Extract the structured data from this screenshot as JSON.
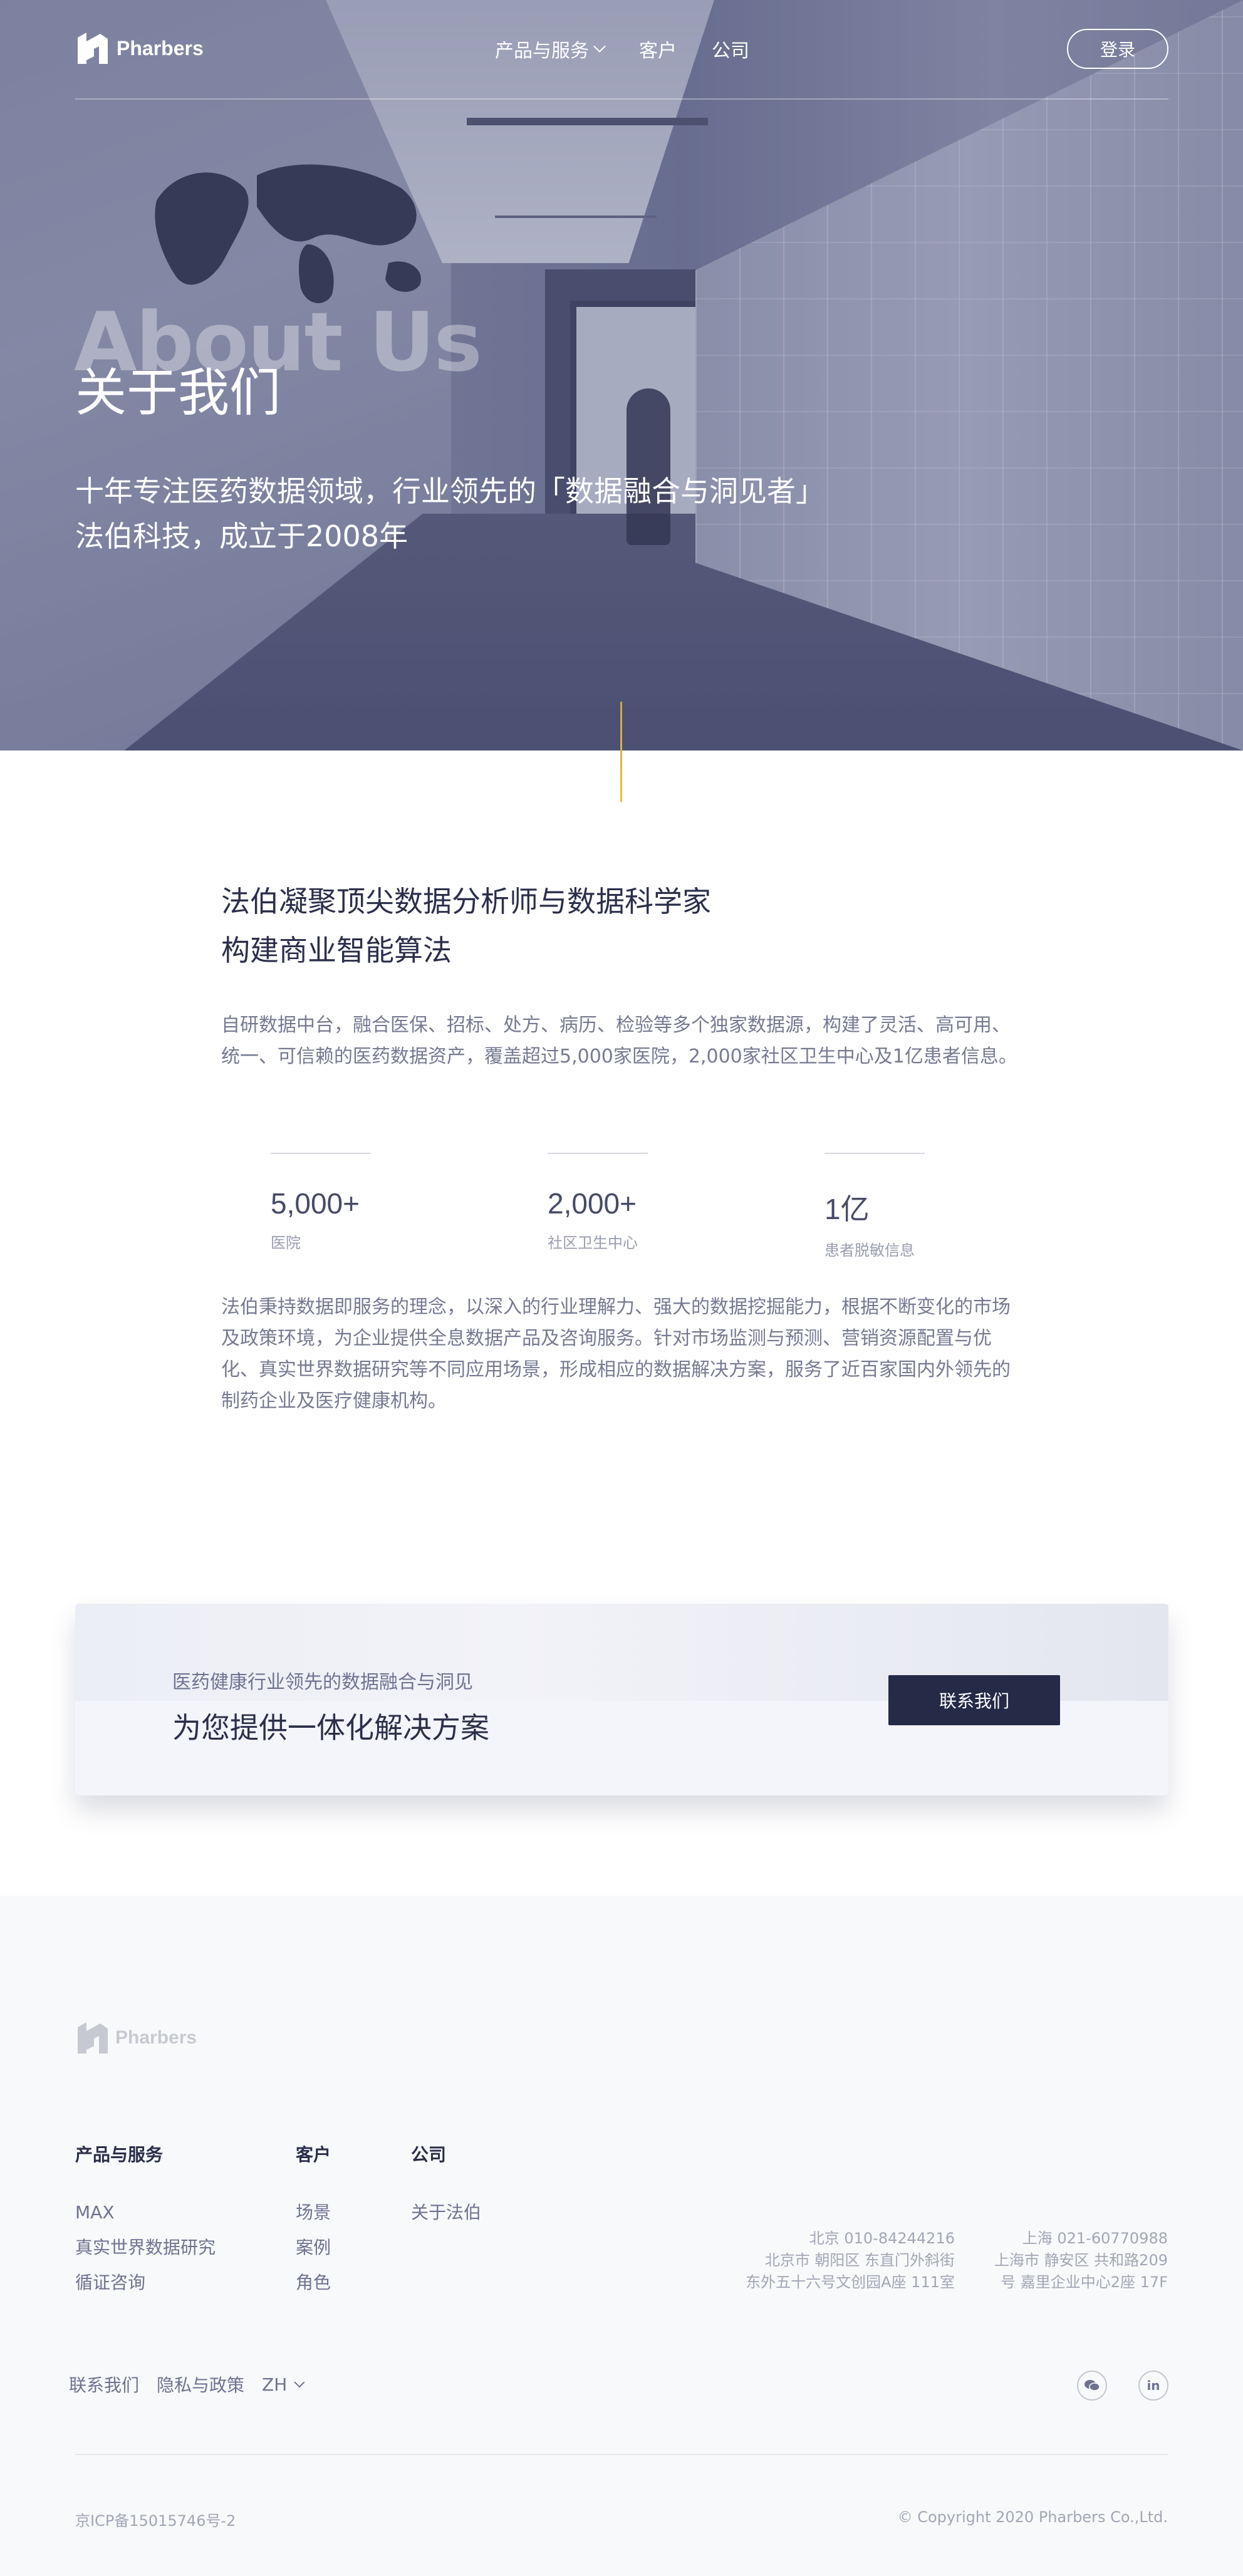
{
  "brand": {
    "name": "Pharbers"
  },
  "nav": {
    "items": [
      {
        "label": "产品与服务",
        "has_dropdown": true
      },
      {
        "label": "客户",
        "has_dropdown": false
      },
      {
        "label": "公司",
        "has_dropdown": false
      }
    ],
    "login_label": "登录"
  },
  "hero": {
    "watermark": "About Us",
    "title": "关于我们",
    "subtitle_line1": "十年专注医药数据领域，行业领先的「数据融合与洞见者」",
    "subtitle_line2": "法伯科技，成立于2008年"
  },
  "about": {
    "heading_line1": "法伯凝聚顶尖数据分析师与数据科学家",
    "heading_line2": "构建商业智能算法",
    "paragraph1": "自研数据中台，融合医保、招标、处方、病历、检验等多个独家数据源，构建了灵活、高可用、统一、可信赖的医药数据资产，覆盖超过5,000家医院，2,000家社区卫生中心及1亿患者信息。",
    "stats": [
      {
        "value": "5,000+",
        "label": "医院"
      },
      {
        "value": "2,000+",
        "label": "社区卫生中心"
      },
      {
        "value": "1亿",
        "label": "患者脱敏信息"
      }
    ],
    "paragraph2": "法伯秉持数据即服务的理念，以深入的行业理解力、强大的数据挖掘能力，根据不断变化的市场及政策环境，为企业提供全息数据产品及咨询服务。针对市场监测与预测、营销资源配置与优化、真实世界数据研究等不同应用场景，形成相应的数据解决方案，服务了近百家国内外领先的制药企业及医疗健康机构。"
  },
  "cta": {
    "small": "医药健康行业领先的数据融合与洞见",
    "big": "为您提供一体化解决方案",
    "button": "联系我们"
  },
  "footer": {
    "columns": [
      {
        "heading": "产品与服务",
        "items": [
          "MAX",
          "真实世界数据研究",
          "循证咨询"
        ]
      },
      {
        "heading": "客户",
        "items": [
          "场景",
          "案例",
          "角色"
        ]
      },
      {
        "heading": "公司",
        "items": [
          "关于法伯"
        ]
      }
    ],
    "offices": [
      {
        "line1": "北京  010-84244216",
        "line2": "北京市 朝阳区 东直门外斜街",
        "line3": "东外五十六号文创园A座 111室"
      },
      {
        "line1": "上海  021-60770988",
        "line2": "上海市 静安区 共和路209",
        "line3": "号 嘉里企业中心2座 17F"
      }
    ],
    "links": {
      "contact": "联系我们",
      "privacy": "隐私与政策",
      "lang": "ZH"
    },
    "social": {
      "wechat": "wechat-icon",
      "linkedin": "in"
    },
    "icp": "京ICP备15015746号-2",
    "copyright": "© Copyright 2020 Pharbers Co.,Ltd."
  },
  "colors": {
    "accent_line": "#e7c137",
    "cta_button": "#252a47",
    "heading": "#2b2f4a",
    "body_text": "#767a91"
  }
}
